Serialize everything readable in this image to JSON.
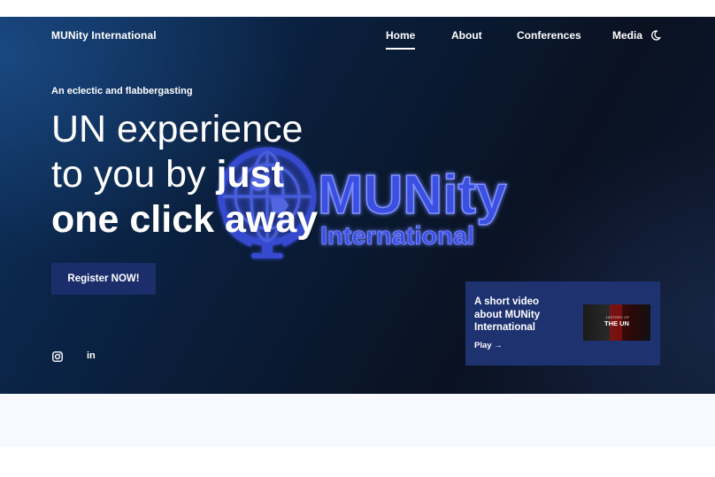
{
  "header": {
    "brand": "MUNity International",
    "nav": {
      "home": "Home",
      "about": "About",
      "conferences": "Conferences",
      "media": "Media"
    },
    "theme_toggle_icon": "moon-icon"
  },
  "hero": {
    "tagline": "An eclectic and flabbergasting",
    "headline": {
      "line1": "UN experience",
      "line2_plain": "to you by ",
      "line2_bold": "just",
      "line3": "one click away"
    },
    "logo": {
      "word1": "MUNity",
      "word2": "International",
      "icon": "globe-icon"
    },
    "register_label": "Register NOW!",
    "social": [
      "instagram-icon",
      "linkedin-icon"
    ],
    "linkedin_text": "in"
  },
  "video_card": {
    "title": "A short video about MUNity International",
    "play_label": "Play",
    "thumbnail": {
      "small_text": "HISTORY OF",
      "big_text": "THE UN"
    }
  },
  "colors": {
    "hero_dark": "#0a1222",
    "hero_blue": "#0c2f5b",
    "button": "#1b2e6b",
    "card": "#1e3270",
    "logo_blue": "#3a4fe0",
    "lower_bg": "#f7f9fe"
  }
}
